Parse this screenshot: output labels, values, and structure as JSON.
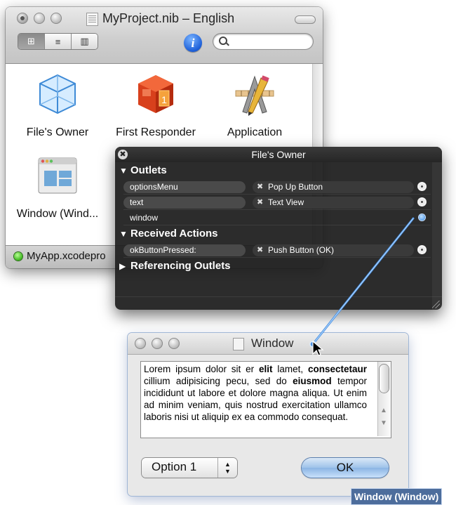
{
  "nib_window": {
    "title": "MyProject.nib – English",
    "view_modes": [
      "icons",
      "list",
      "columns"
    ],
    "active_view_mode": "icons",
    "info_label": "i",
    "search_placeholder": "",
    "objects": [
      {
        "label": "File's Owner",
        "icon": "cube-icon"
      },
      {
        "label": "First Responder",
        "icon": "first-responder-icon"
      },
      {
        "label": "Application",
        "icon": "application-icon"
      },
      {
        "label": "Window (Wind...",
        "icon": "window-icon"
      }
    ],
    "status": "MyApp.xcodepro",
    "status_color": "#3bb51c"
  },
  "connections_panel": {
    "title": "File's Owner",
    "close_glyph": "✖",
    "sections": {
      "outlets": "Outlets",
      "received_actions": "Received Actions",
      "referencing_outlets": "Referencing Outlets"
    },
    "outlets": [
      {
        "name": "optionsMenu",
        "target": "Pop Up Button"
      },
      {
        "name": "text",
        "target": "Text View"
      },
      {
        "name": "window",
        "target": ""
      }
    ],
    "actions": [
      {
        "name": "okButtonPressed:",
        "target": "Push Button (OK)"
      }
    ],
    "x_glyph": "✖",
    "connection_color": "#4a90e2"
  },
  "window": {
    "title": "Window",
    "text_segments": [
      {
        "t": "Lorem ipsum dolor sit er ",
        "b": false
      },
      {
        "t": "elit",
        "b": true
      },
      {
        "t": " lamet, ",
        "b": false
      },
      {
        "t": "consectetaur",
        "b": true
      },
      {
        "t": " cillium adipisicing pecu, sed do ",
        "b": false
      },
      {
        "t": "eiusmod",
        "b": true
      },
      {
        "t": " tempor incididunt ut labore et dolore magna aliqua. Ut enim ad minim veniam, quis nostrud exercitation ullamco laboris nisi ut aliquip ex ea commodo consequat.",
        "b": false
      }
    ],
    "popup_value": "Option 1",
    "ok_label": "OK"
  },
  "tooltip": "Window (Window)"
}
